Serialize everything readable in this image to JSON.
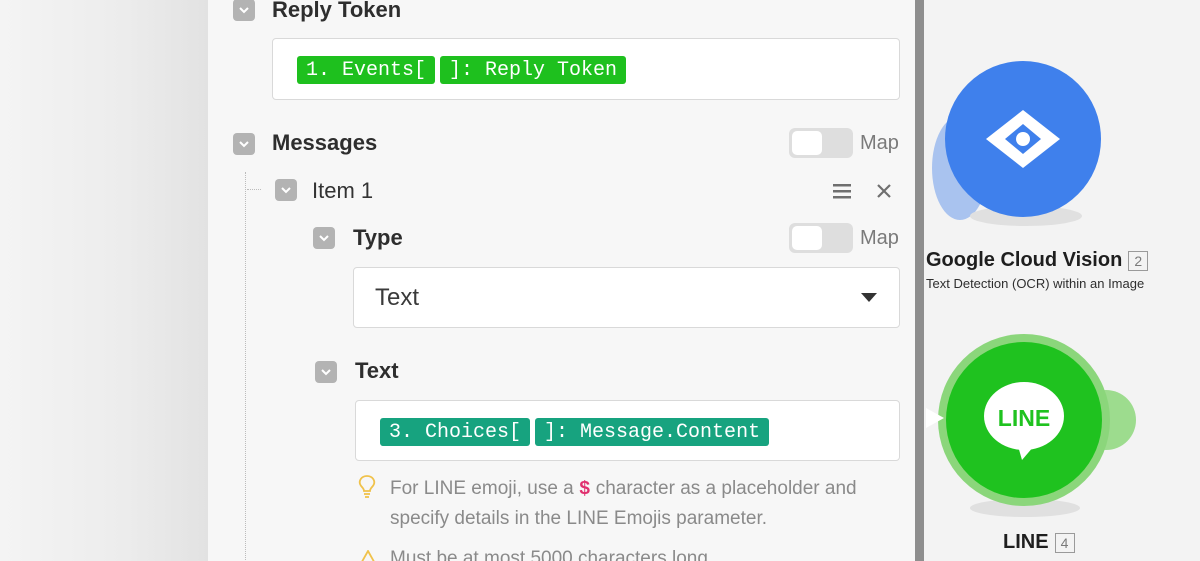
{
  "reply_token": {
    "label": "Reply Token",
    "pills": [
      "1. Events[",
      "]: Reply Token"
    ]
  },
  "messages": {
    "label": "Messages",
    "map_label": "Map",
    "item": {
      "label": "Item 1",
      "type": {
        "label": "Type",
        "map_label": "Map",
        "selected": "Text"
      },
      "text": {
        "label": "Text",
        "pills": [
          "3. Choices[",
          "]: Message.Content"
        ]
      },
      "hint_part1": "For LINE emoji, use a",
      "hint_symbol": "$",
      "hint_part2": "character as a placeholder and",
      "hint_line2": "specify details in the LINE Emojis parameter.",
      "warning": "Must be at most 5000 characters long."
    }
  },
  "modules": [
    {
      "title": "Google Cloud Vision",
      "number": "2",
      "subtitle": "Text Detection (OCR) within an Image",
      "color": "#3f80ec"
    },
    {
      "title": "LINE",
      "number": "4",
      "logo_text": "LINE",
      "color": "#1fc21f"
    }
  ]
}
